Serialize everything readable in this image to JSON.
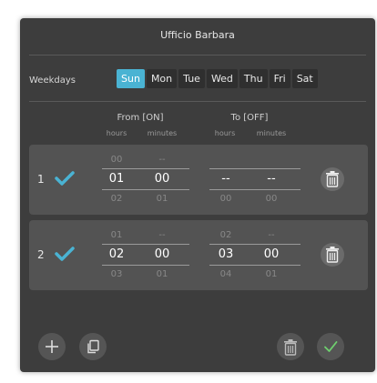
{
  "dialog": {
    "title": "Ufficio Barbara"
  },
  "weekdays": {
    "label": "Weekdays",
    "days": [
      "Sun",
      "Mon",
      "Tue",
      "Wed",
      "Thu",
      "Fri",
      "Sat"
    ],
    "selected": "Sun"
  },
  "columns": {
    "from": "From [ON]",
    "to": "To [OFF]",
    "hours": "hours",
    "minutes": "minutes"
  },
  "rows": [
    {
      "index": "1",
      "checked": true,
      "from": {
        "hours": [
          "00",
          "01",
          "02"
        ],
        "minutes": [
          "--",
          "00",
          "01"
        ]
      },
      "to": {
        "hours": [
          "",
          "--",
          "00"
        ],
        "minutes": [
          "",
          "--",
          "00"
        ]
      }
    },
    {
      "index": "2",
      "checked": true,
      "from": {
        "hours": [
          "01",
          "02",
          "03"
        ],
        "minutes": [
          "--",
          "00",
          "01"
        ]
      },
      "to": {
        "hours": [
          "02",
          "03",
          "04"
        ],
        "minutes": [
          "--",
          "00",
          "01"
        ]
      }
    }
  ],
  "footer": {
    "icons": [
      "add-icon",
      "copy-icon",
      "trash-icon",
      "check-icon"
    ]
  },
  "colors": {
    "accent": "#4ab3d3",
    "dialog_bg": "#3d3d3d",
    "row_bg": "#535353",
    "confirm_green": "#6fcf6f"
  }
}
